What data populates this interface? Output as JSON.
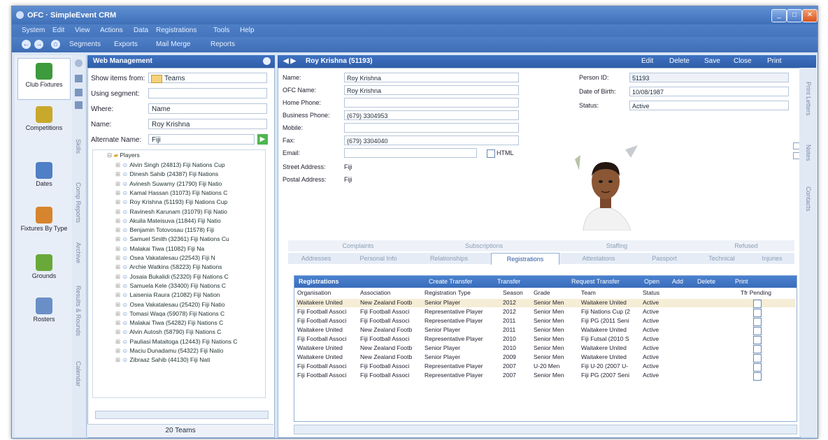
{
  "window": {
    "title": "OFC · SimpleEvent CRM"
  },
  "menu": [
    "System",
    "Edit",
    "View",
    "Actions",
    "Data",
    "Registrations",
    "Tools",
    "Help"
  ],
  "toolbar": {
    "back": "←",
    "forward": "→",
    "home": "⌂",
    "items": [
      "Segments",
      "Exports",
      "Mail Merge",
      "Reports"
    ]
  },
  "leftnav": [
    {
      "label": "Club Fixtures",
      "color": "#3d9a3d"
    },
    {
      "label": "Competitions",
      "color": "#c8a92b"
    },
    {
      "label": "Dates",
      "color": "#4f7fc4"
    },
    {
      "label": "Fixtures By Type",
      "color": "#d7842e"
    },
    {
      "label": "Grounds",
      "color": "#69a93a"
    },
    {
      "label": "Rosters",
      "color": "#6a8fc7"
    }
  ],
  "vstrip_tabs": [
    "Skills",
    "Comp Reports",
    "Archive",
    "Results & Rounds",
    "Calendar"
  ],
  "web": {
    "title": "Web Management",
    "fields": [
      {
        "label": "Show items from:",
        "value": "Teams"
      },
      {
        "label": "Using segment:",
        "value": ""
      },
      {
        "label": "Where:",
        "value": "Name"
      },
      {
        "label": "Name:",
        "value": "Roy Krishna"
      },
      {
        "label": "Alternate Name:",
        "value": "Fiji"
      }
    ],
    "tree_root": "Players",
    "tree": [
      "Alvin Singh (24813) Fiji Nations Cup",
      "Dinesh Sahib (24387) Fiji Nations",
      "Avinesh Suwamy (21790) Fiji Natio",
      "Kamal Hassan (31073) Fiji Nations C",
      "Roy Krishna (51193) Fiji Nations Cup",
      "Ravinesh Karunam (31079) Fiji Natio",
      "Akuila Mateisuva (11844) Fiji Natio",
      "Benjamin Totovosau (11578) Fiji",
      "Samuel Smith (32361) Fiji Nations Cu",
      "Malakai Tiwa (11082) Fiji Na",
      "Osea Vakatalesau (22543) Fiji N",
      "Archie Watkins (58223) Fiji Nations",
      "Josaia Bukalidi (52320) Fiji Nations C",
      "Samuela Kele (33400) Fiji Nations C",
      "Laisenia Raura (21082) Fiji Nation",
      "Osea Vakatalesau (25420) Fiji Natio",
      "Tomasi Waqa (59078) Fiji Nations C",
      "Malakai Tiwa (54282) Fiji Nations C",
      "Alvin Autosh (58790) Fiji Nations C",
      "Pauliasi Mataitoga (12443) Fiji Nations C",
      "Maciu Dunadamu (54322) Fiji Natio",
      "Zibraaz Sahib (44130) Fiji Nati"
    ],
    "footer": "20 Teams"
  },
  "person": {
    "header": "Roy Krishna (51193)",
    "header_actions": [
      "Edit",
      "Delete",
      "Save",
      "Close",
      "Print"
    ],
    "name_label": "Name:",
    "name": "Roy Krishna",
    "ofc_label": "OFC Name:",
    "ofc": "Roy Krishna",
    "home_label": "Home Phone:",
    "home": "",
    "business_label": "Business Phone:",
    "business": "(679) 3304953",
    "mobile_label": "Mobile:",
    "mobile": "",
    "fax_label": "Fax:",
    "fax": "(679) 3304040",
    "email_label": "Email:",
    "email": "",
    "html_label": "HTML",
    "street_label": "Street Address:",
    "street": "Fiji",
    "postal_label": "Postal Address:",
    "postal": "Fiji",
    "id_label": "Person ID:",
    "id": "51193",
    "dob_label": "Date of Birth:",
    "dob": "10/08/1987",
    "status_label": "Status:",
    "status": "Active"
  },
  "tabs_top": [
    "Complaints",
    "Subscriptions",
    "Staffing",
    "Refused"
  ],
  "tabs_bottom": [
    "Addresses",
    "Personal Info",
    "Relationships",
    "Registrations",
    "Attestations",
    "Passport",
    "Technical",
    "Injuries"
  ],
  "selected_tab": "Registrations",
  "registrations": {
    "title": "Registrations",
    "actions": [
      "Create Transfer",
      "Transfer",
      "Request Transfer",
      "Open",
      "Add",
      "Delete",
      "Print"
    ],
    "columns": [
      "Organisation",
      "Association",
      "Registration Type",
      "Season",
      "Grade",
      "Team",
      "Status",
      "Tfr Pending"
    ],
    "rows": [
      [
        "Waitakere United",
        "New Zealand Footb",
        "Senior Player",
        "2012",
        "Senior Men",
        "Waitakere United",
        "Active"
      ],
      [
        "Fiji Football Associ",
        "Fiji Football Associ",
        "Representative Player",
        "2012",
        "Senior Men",
        "Fiji Nations Cup (2",
        "Active"
      ],
      [
        "Fiji Football Associ",
        "Fiji Football Associ",
        "Representative Player",
        "2011",
        "Senior Men",
        "Fiji PG (2011 Seni",
        "Active"
      ],
      [
        "Waitakere United",
        "New Zealand Footb",
        "Senior Player",
        "2011",
        "Senior Men",
        "Waitakere United",
        "Active"
      ],
      [
        "Fiji Football Associ",
        "Fiji Football Associ",
        "Representative Player",
        "2010",
        "Senior Men",
        "Fiji Futsal (2010 S",
        "Active"
      ],
      [
        "Waitakere United",
        "New Zealand Footb",
        "Senior Player",
        "2010",
        "Senior Men",
        "Waitakere United",
        "Active"
      ],
      [
        "Waitakere United",
        "New Zealand Footb",
        "Senior Player",
        "2009",
        "Senior Men",
        "Waitakere United",
        "Active"
      ],
      [
        "Fiji Football Associ",
        "Fiji Football Associ",
        "Representative Player",
        "2007",
        "U-20 Men",
        "Fiji U-20 (2007 U-",
        "Active"
      ],
      [
        "Fiji Football Associ",
        "Fiji Football Associ",
        "Representative Player",
        "2007",
        "Senior Men",
        "Fiji PG (2007 Seni",
        "Active"
      ]
    ]
  },
  "right_tabs": [
    "Print Letters",
    "Notes",
    "Contacts"
  ],
  "colors": {
    "accent": "#3f72c2",
    "selected_row": "#f5edd5"
  }
}
